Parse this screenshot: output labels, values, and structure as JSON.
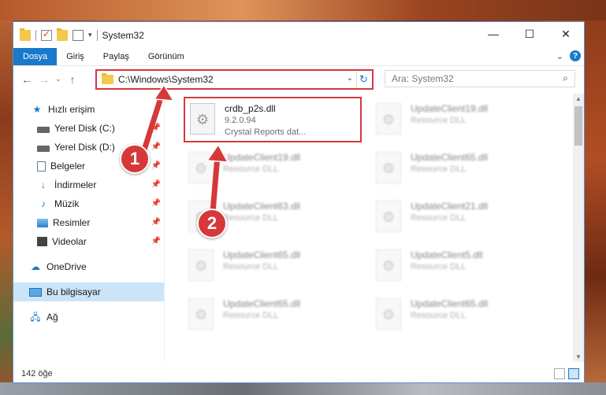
{
  "window": {
    "title": "System32",
    "controls": {
      "minimize": "—",
      "maximize": "☐",
      "close": "✕"
    }
  },
  "ribbon": {
    "tabs": [
      "Dosya",
      "Giriş",
      "Paylaş",
      "Görünüm"
    ],
    "expand": "⌄",
    "help": "?"
  },
  "address": {
    "path": "C:\\Windows\\System32",
    "search_placeholder": "Ara: System32"
  },
  "nav": {
    "back": "←",
    "forward": "→",
    "recent": "⌄",
    "up": "↑"
  },
  "sidebar": {
    "items": [
      {
        "label": "Hızlı erişim",
        "icon": "star-icon"
      },
      {
        "label": "Yerel Disk (C:)",
        "icon": "drive-icon",
        "pinned": true
      },
      {
        "label": "Yerel Disk (D:)",
        "icon": "drive-icon",
        "pinned": true
      },
      {
        "label": "Belgeler",
        "icon": "documents-icon",
        "pinned": true
      },
      {
        "label": "İndirmeler",
        "icon": "downloads-icon",
        "pinned": true
      },
      {
        "label": "Müzik",
        "icon": "music-icon",
        "pinned": true
      },
      {
        "label": "Resimler",
        "icon": "pictures-icon",
        "pinned": true
      },
      {
        "label": "Videolar",
        "icon": "videos-icon",
        "pinned": true
      },
      {
        "label": "OneDrive",
        "icon": "cloud-icon"
      },
      {
        "label": "Bu bilgisayar",
        "icon": "computer-icon",
        "selected": true
      },
      {
        "label": "Ağ",
        "icon": "network-icon"
      }
    ]
  },
  "files": [
    {
      "name": "crdb_p2s.dll",
      "version": "9.2.0.94",
      "desc": "Crystal Reports dat...",
      "highlight": true
    },
    {
      "name": "UpdateClient19.dll",
      "desc": "Resource DLL"
    },
    {
      "name": "UpdateClient19.dll",
      "desc": "Resource DLL"
    },
    {
      "name": "UpdateClient65.dll",
      "desc": "Resource DLL"
    },
    {
      "name": "UpdateClient63.dll",
      "desc": "Resource DLL"
    },
    {
      "name": "UpdateClient21.dll",
      "desc": "Resource DLL"
    },
    {
      "name": "UpdateClient65.dll",
      "desc": "Resource DLL"
    },
    {
      "name": "UpdateClient5.dll",
      "desc": "Resource DLL"
    },
    {
      "name": "UpdateClient65.dll",
      "desc": "Resource DLL"
    },
    {
      "name": "UpdateClient65.dll",
      "desc": "Resource DLL"
    }
  ],
  "status": {
    "count": "142 öğe"
  },
  "annotations": {
    "step1": "1",
    "step2": "2",
    "color": "#d6383a"
  }
}
